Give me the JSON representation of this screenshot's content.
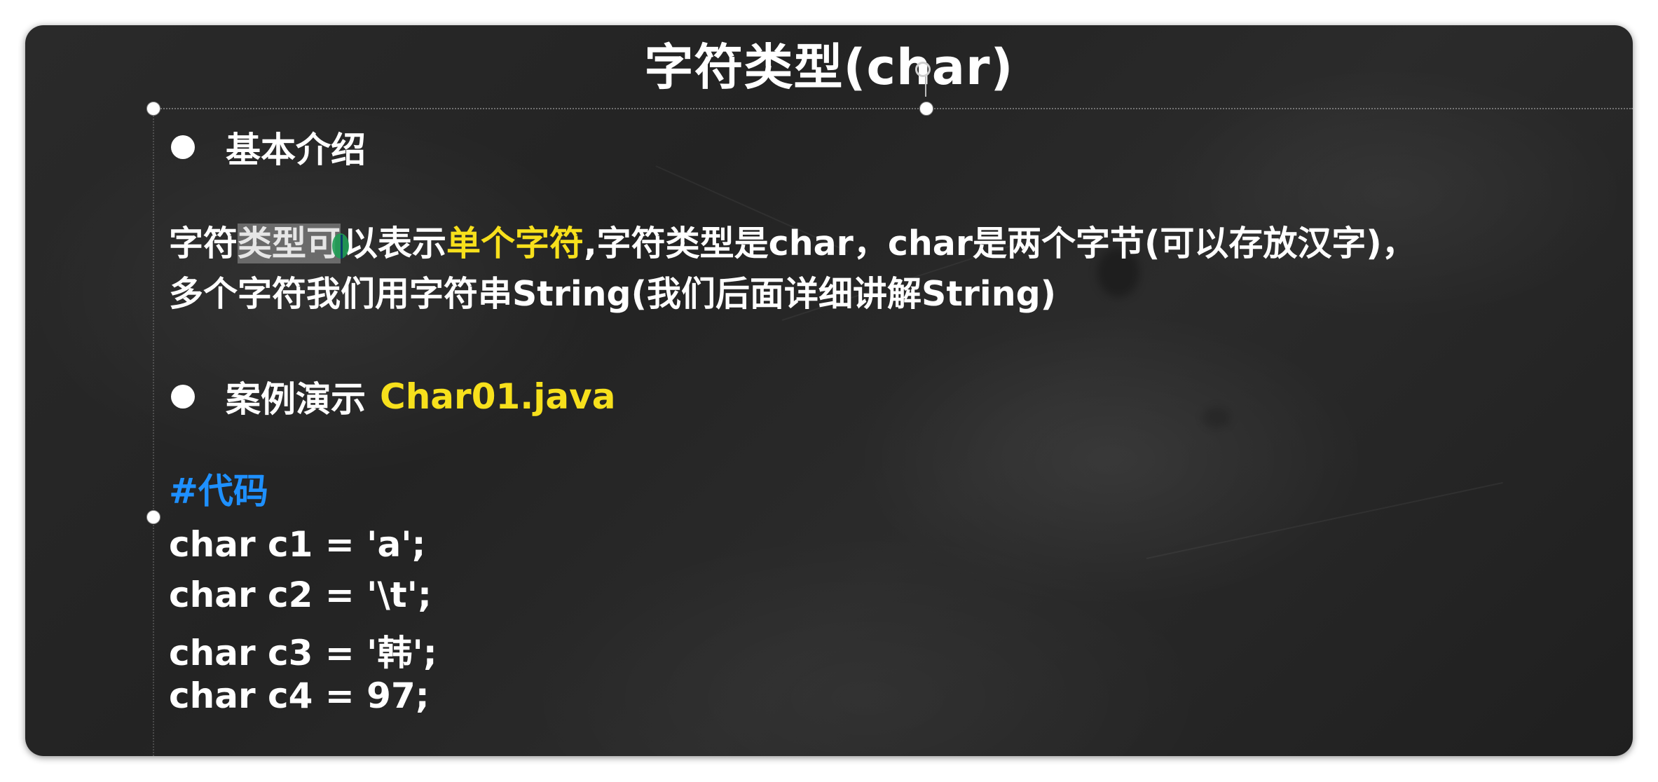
{
  "slide": {
    "title": "字符类型(char)",
    "section1": {
      "heading": "基本介绍",
      "line1_part1": "字符",
      "line1_selected": "类型可",
      "line1_part2": "以表示",
      "line1_highlight": "单个字符",
      "line1_part3": ",字符类型是char，char是两个字节(可以存放汉字)，",
      "line2": "多个字符我们用字符串String(我们后面详细讲解String)"
    },
    "section2": {
      "heading": "案例演示",
      "file": "Char01.java"
    },
    "code": {
      "comment": "#代码",
      "lines": [
        "char c1 = 'a';",
        "char c2 = '\\t';",
        "char c3 = '韩';",
        "char c4 = 97;"
      ]
    }
  },
  "colors": {
    "highlight_yellow": "#f7e01c",
    "comment_blue": "#1e90ff",
    "text": "#ffffff",
    "board": "#262626"
  },
  "icons": [
    "bullet-icon",
    "rotate-handle-icon",
    "selection-handle-icon",
    "text-cursor-icon"
  ]
}
